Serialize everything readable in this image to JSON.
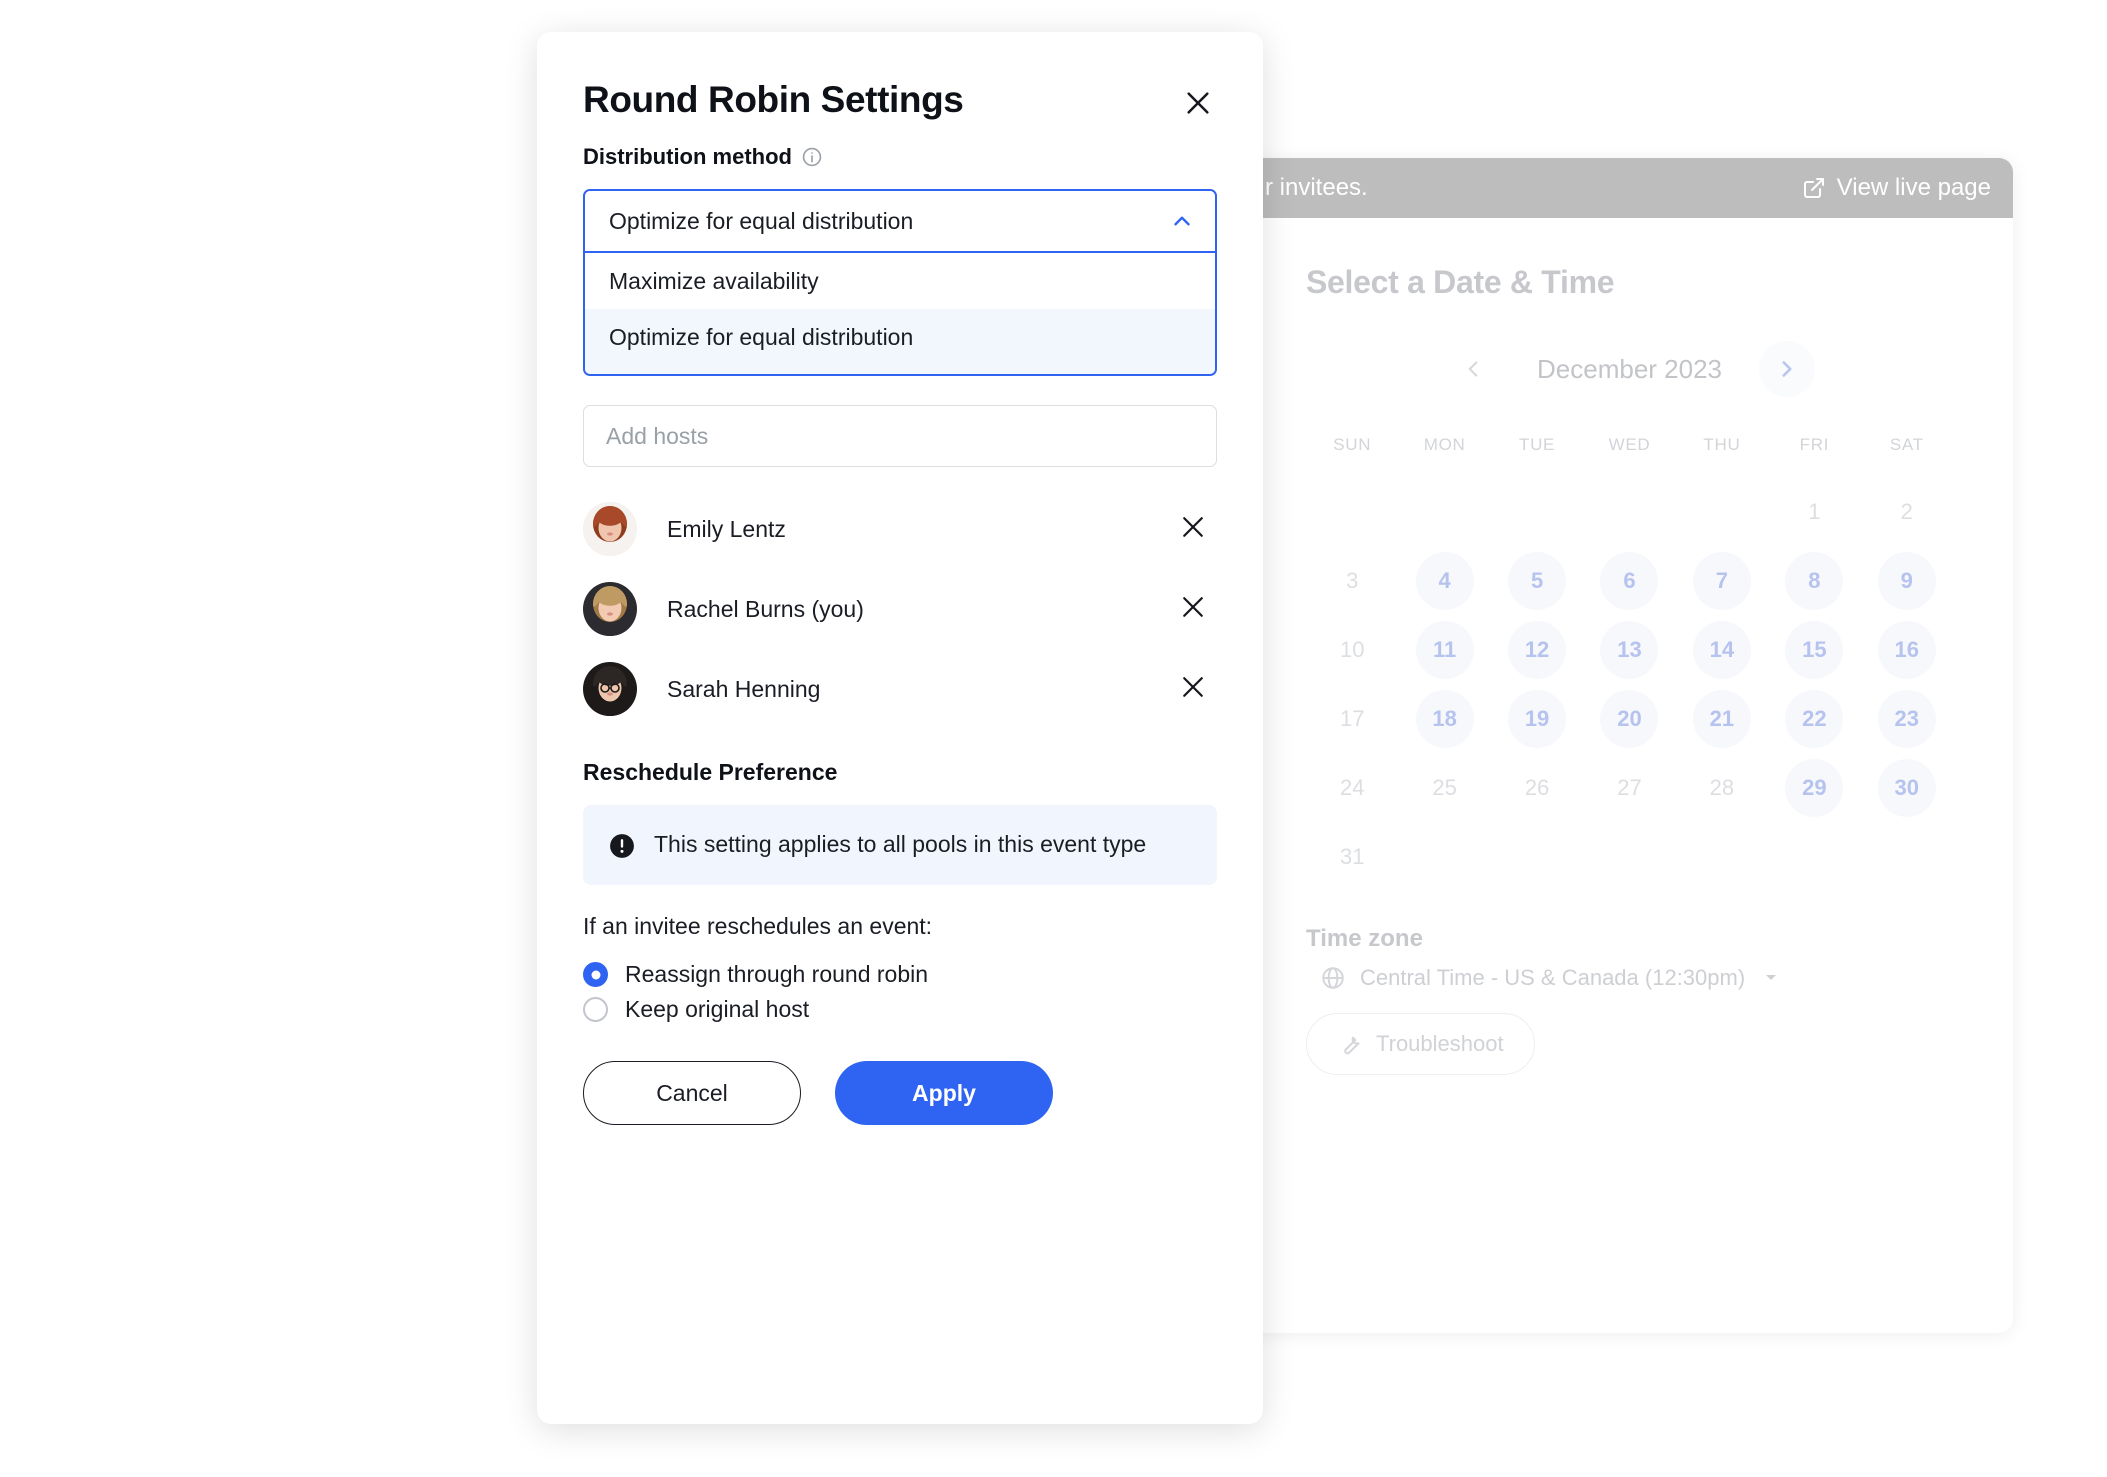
{
  "background_page": {
    "banner": {
      "message": "r invitees.",
      "view_live_label": "View live page",
      "icon": "external-link-icon"
    },
    "heading": "Select a Date & Time",
    "calendar": {
      "prev_icon": "chevron-left-icon",
      "next_icon": "chevron-right-icon",
      "month_label": "December 2023",
      "day_headers": [
        "SUN",
        "MON",
        "TUE",
        "WED",
        "THU",
        "FRI",
        "SAT"
      ],
      "weeks": [
        [
          {
            "label": "",
            "state": "empty"
          },
          {
            "label": "",
            "state": "empty"
          },
          {
            "label": "",
            "state": "empty"
          },
          {
            "label": "",
            "state": "empty"
          },
          {
            "label": "",
            "state": "empty"
          },
          {
            "label": "1",
            "state": "dim"
          },
          {
            "label": "2",
            "state": "dim"
          }
        ],
        [
          {
            "label": "3",
            "state": "dim"
          },
          {
            "label": "4",
            "state": "available",
            "dot": true
          },
          {
            "label": "5",
            "state": "available"
          },
          {
            "label": "6",
            "state": "available"
          },
          {
            "label": "7",
            "state": "available"
          },
          {
            "label": "8",
            "state": "available"
          },
          {
            "label": "9",
            "state": "available"
          }
        ],
        [
          {
            "label": "10",
            "state": "dim"
          },
          {
            "label": "11",
            "state": "available"
          },
          {
            "label": "12",
            "state": "available"
          },
          {
            "label": "13",
            "state": "available"
          },
          {
            "label": "14",
            "state": "available"
          },
          {
            "label": "15",
            "state": "available"
          },
          {
            "label": "16",
            "state": "available"
          }
        ],
        [
          {
            "label": "17",
            "state": "dim"
          },
          {
            "label": "18",
            "state": "available"
          },
          {
            "label": "19",
            "state": "available"
          },
          {
            "label": "20",
            "state": "available"
          },
          {
            "label": "21",
            "state": "available"
          },
          {
            "label": "22",
            "state": "available"
          },
          {
            "label": "23",
            "state": "available"
          }
        ],
        [
          {
            "label": "24",
            "state": "dim"
          },
          {
            "label": "25",
            "state": "dim"
          },
          {
            "label": "26",
            "state": "dim"
          },
          {
            "label": "27",
            "state": "dim"
          },
          {
            "label": "28",
            "state": "dim"
          },
          {
            "label": "29",
            "state": "available"
          },
          {
            "label": "30",
            "state": "available"
          }
        ],
        [
          {
            "label": "31",
            "state": "dim"
          },
          {
            "label": "",
            "state": "empty"
          },
          {
            "label": "",
            "state": "empty"
          },
          {
            "label": "",
            "state": "empty"
          },
          {
            "label": "",
            "state": "empty"
          },
          {
            "label": "",
            "state": "empty"
          },
          {
            "label": "",
            "state": "empty"
          }
        ]
      ]
    },
    "timezone": {
      "title": "Time zone",
      "icon": "globe-icon",
      "value": "Central Time - US & Canada (12:30pm)",
      "caret": "caret-down-icon"
    },
    "troubleshoot": {
      "icon": "wrench-icon",
      "label": "Troubleshoot"
    }
  },
  "modal": {
    "title": "Round Robin Settings",
    "close_icon": "close-icon",
    "distribution": {
      "label": "Distribution method",
      "info_icon": "info-circle-icon",
      "selected": "Optimize for equal distribution",
      "chevron_icon": "chevron-up-icon",
      "options": [
        {
          "label": "Maximize availability",
          "selected": false
        },
        {
          "label": "Optimize for equal distribution",
          "selected": true
        }
      ]
    },
    "add_hosts_placeholder": "Add hosts",
    "hosts": [
      {
        "name": "Emily Lentz",
        "remove_icon": "close-icon",
        "avatar": "avatar-emily"
      },
      {
        "name": "Rachel Burns (you)",
        "remove_icon": "close-icon",
        "avatar": "avatar-rachel"
      },
      {
        "name": "Sarah Henning",
        "remove_icon": "close-icon",
        "avatar": "avatar-sarah"
      }
    ],
    "reschedule": {
      "title": "Reschedule Preference",
      "notice_icon": "exclamation-circle-icon",
      "notice": "This setting applies to all pools in this event type",
      "prompt": "If an invitee reschedules an event:",
      "options": [
        {
          "label": "Reassign through round robin",
          "selected": true
        },
        {
          "label": "Keep original host",
          "selected": false
        }
      ]
    },
    "cancel_label": "Cancel",
    "apply_label": "Apply"
  },
  "colors": {
    "accent_blue": "#2F63F2",
    "available_day": "#B6C3EF",
    "notice_bg": "#F1F5FD",
    "option_selected_bg": "#F2F6FD",
    "banner_gray": "#BDBDBD"
  }
}
